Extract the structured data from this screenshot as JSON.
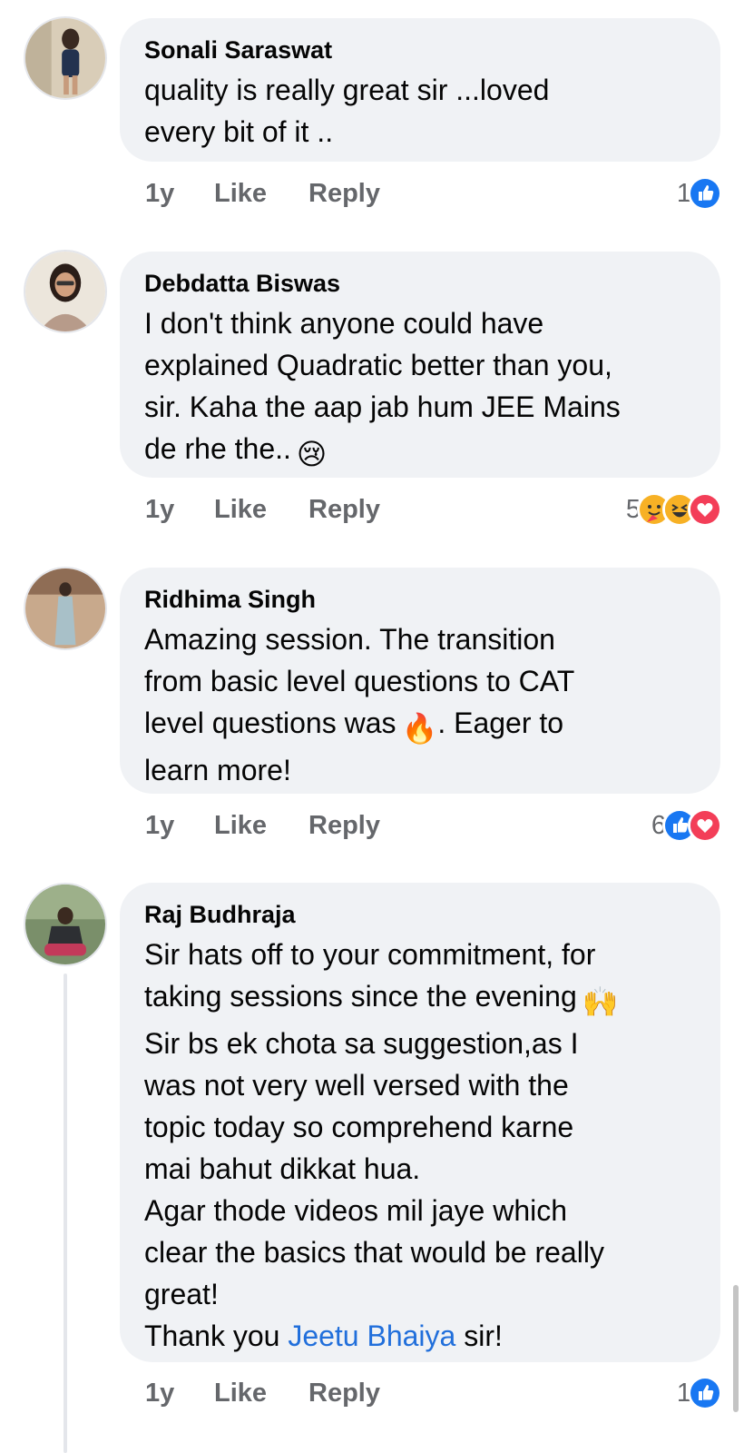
{
  "comments": [
    {
      "author": "Sonali Saraswat",
      "lines": [
        "quality is really  great sir ...loved",
        "every bit of it .."
      ],
      "time": "1y",
      "like_label": "Like",
      "reply_label": "Reply",
      "reaction_count": "1",
      "reactions": [
        "like"
      ]
    },
    {
      "author": "Debdatta Biswas",
      "lines": [
        "I don't think anyone could have",
        "explained Quadratic better than you,",
        "sir. Kaha the aap jab hum JEE Mains",
        "de rhe the.."
      ],
      "emoji": "😢",
      "time": "1y",
      "like_label": "Like",
      "reply_label": "Reply",
      "reaction_count": "5",
      "reactions": [
        "care",
        "haha",
        "love"
      ]
    },
    {
      "author": "Ridhima Singh",
      "lines": [
        "Amazing session. The transition",
        "from basic level questions to CAT",
        "level questions was",
        "learn more!"
      ],
      "emoji": "🔥",
      "line3_suffix": ". Eager to",
      "time": "1y",
      "like_label": "Like",
      "reply_label": "Reply",
      "reaction_count": "6",
      "reactions": [
        "like",
        "love"
      ]
    },
    {
      "author": "Raj Budhraja",
      "lines": [
        "Sir hats off to your commitment, for",
        "taking sessions since the evening",
        "Sir bs ek chota sa suggestion,as I",
        "was not very well versed with the",
        "topic today so comprehend karne",
        "mai bahut dikkat hua.",
        "Agar thode videos mil jaye which",
        "clear the basics that would be really",
        "great!",
        "Thank you",
        "sir!"
      ],
      "emoji": "🙌",
      "mention": "Jeetu Bhaiya",
      "time": "1y",
      "like_label": "Like",
      "reply_label": "Reply",
      "reaction_count": "1",
      "reactions": [
        "like"
      ]
    }
  ],
  "colors": {
    "bubble": "#f0f2f5",
    "meta": "#65676b",
    "mention": "#216fdb",
    "like": "#1877f2",
    "love": "#f33e58",
    "haha": "#f7b125"
  }
}
